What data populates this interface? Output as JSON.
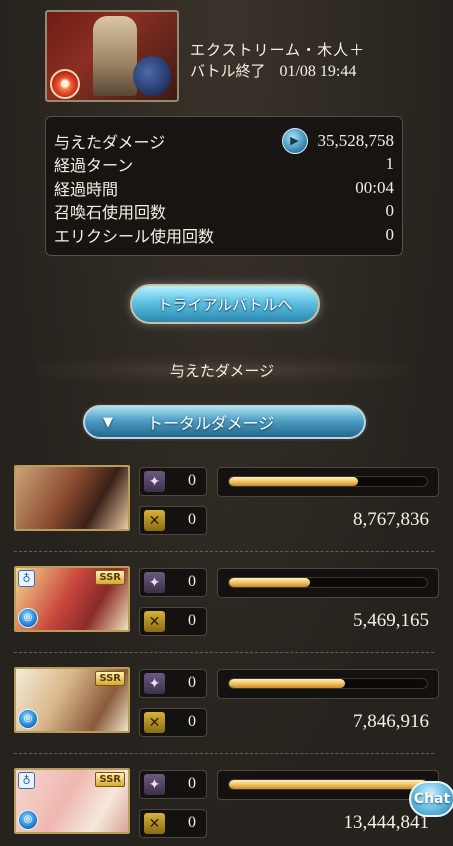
{
  "quest": {
    "name": "エクストリーム・木人＋",
    "status": "バトル終了",
    "datetime": "01/08 19:44",
    "element_icon": "fire-element-icon"
  },
  "stats": {
    "damage_label": "与えたダメージ",
    "damage_value": "35,528,758",
    "turns_label": "経過ターン",
    "turns_value": "1",
    "time_label": "経過時間",
    "time_value": "00:04",
    "summons_label": "召喚石使用回数",
    "summons_value": "0",
    "elixir_label": "エリクシール使用回数",
    "elixir_value": "0"
  },
  "trial_button": "トライアルバトルへ",
  "section_title": "与えたダメージ",
  "dropdown": {
    "arrow": "▼",
    "label": "トータルダメージ"
  },
  "characters": [
    {
      "skill_uses": "0",
      "ca_uses": "0",
      "damage": "8,767,836",
      "share": 0.652,
      "ssr": "",
      "ring": ""
    },
    {
      "skill_uses": "0",
      "ca_uses": "0",
      "damage": "5,469,165",
      "share": 0.407,
      "ssr": "SSR",
      "ring": "♁"
    },
    {
      "skill_uses": "0",
      "ca_uses": "0",
      "damage": "7,846,916",
      "share": 0.584,
      "ssr": "SSR",
      "ring": ""
    },
    {
      "skill_uses": "0",
      "ca_uses": "0",
      "damage": "13,444,841",
      "share": 1.0,
      "ssr": "SSR",
      "ring": "♁"
    }
  ],
  "chat_label": "Chat",
  "colors": {
    "bar_fill": "#f0c463",
    "accent_blue": "#4f9ec4",
    "background": "#2b2620"
  }
}
